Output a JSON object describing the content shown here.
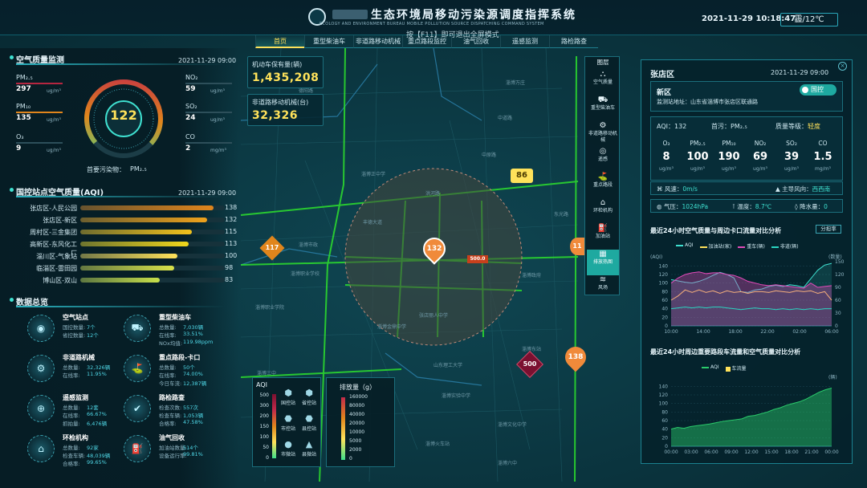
{
  "header": {
    "title": "生态环境局移动污染源调度指挥系统",
    "subtitle": "ECOLOGY AND ENVIRONMENT BUREAU MOBILE POLLUTION SOURCE DISPATCHING COMMAND SYSTEM",
    "datetime": "2021-11-29 10:18:47",
    "weather": "霾/12℃",
    "hint": "按【F11】即可退出全屏模式"
  },
  "nav": [
    "首页",
    "重型柴油车",
    "非道路移动机械",
    "重点路段监控",
    "油气回收",
    "遥感监测",
    "路检路查"
  ],
  "air": {
    "title": "空气质量监测",
    "date": "2021-11-29 09:00",
    "aqi": "122",
    "primary_label": "首要污染物：",
    "primary_value": "PM₂.₅",
    "items": [
      {
        "name": "PM₂.₅",
        "value": "297",
        "unit": "ug/m³"
      },
      {
        "name": "NO₂",
        "value": "59",
        "unit": "ug/m³"
      },
      {
        "name": "PM₁₀",
        "value": "135",
        "unit": "ug/m³"
      },
      {
        "name": "SO₂",
        "value": "24",
        "unit": "ug/m³"
      },
      {
        "name": "O₃",
        "value": "9",
        "unit": "ug/m³"
      },
      {
        "name": "CO",
        "value": "2",
        "unit": "mg/m³"
      }
    ]
  },
  "rank": {
    "title": "国控站点空气质量(AQI)",
    "date": "2021-11-29 09:00",
    "rows": [
      {
        "name": "张店区-人民公园",
        "value": "138",
        "frac": 0.92
      },
      {
        "name": "张店区-新区",
        "value": "132",
        "frac": 0.88
      },
      {
        "name": "周村区-三金集团",
        "value": "115",
        "frac": 0.77
      },
      {
        "name": "高新区-东风化工厂",
        "value": "113",
        "frac": 0.75
      },
      {
        "name": "淄川区-气象站",
        "value": "100",
        "frac": 0.67
      },
      {
        "name": "临淄区-雷田园",
        "value": "98",
        "frac": 0.65
      },
      {
        "name": "博山区-双山",
        "value": "83",
        "frac": 0.55
      }
    ]
  },
  "overview": {
    "title": "数据总览",
    "cards": [
      {
        "title": "空气站点",
        "icon": "air-station-icon",
        "glyph": "◉",
        "lines": [
          [
            "国控数量:",
            "7个"
          ],
          [
            "省控数量:",
            "12个"
          ]
        ]
      },
      {
        "title": "重型柴油车",
        "icon": "truck-icon",
        "glyph": "⛟",
        "lines": [
          [
            "总数量:",
            "7,030辆"
          ],
          [
            "在线率:",
            "33.51%"
          ],
          [
            "NOx均值:",
            "119.98ppm"
          ]
        ]
      },
      {
        "title": "非道路机械",
        "icon": "machine-icon",
        "glyph": "⚙",
        "lines": [
          [
            "总数量:",
            "32,326辆"
          ],
          [
            "在线率:",
            "11.95%"
          ]
        ]
      },
      {
        "title": "重点路段-卡口",
        "icon": "checkpoint-icon",
        "glyph": "⛳",
        "lines": [
          [
            "总数量:",
            "50个"
          ],
          [
            "在线率:",
            "74.00%"
          ],
          [
            "今日车流:",
            "12,387辆"
          ]
        ]
      },
      {
        "title": "遥感监测",
        "icon": "remote-sensing-icon",
        "glyph": "⊕",
        "lines": [
          [
            "总数量:",
            "12套"
          ],
          [
            "在线率:",
            "66.67%"
          ],
          [
            "抓拍量:",
            "6,476辆"
          ]
        ]
      },
      {
        "title": "路检路查",
        "icon": "road-check-icon",
        "glyph": "✔",
        "lines": [
          [
            "检查次数:",
            "557次"
          ],
          [
            "检查车辆:",
            "1,053辆"
          ],
          [
            "合格率:",
            "47.58%"
          ]
        ]
      },
      {
        "title": "环检机构",
        "icon": "inspection-icon",
        "glyph": "⌂",
        "lines": [
          [
            "总数量:",
            "92家"
          ],
          [
            "检查车辆:",
            "48,039辆"
          ],
          [
            "合格率:",
            "99.65%"
          ]
        ]
      },
      {
        "title": "油气回收",
        "icon": "fuel-icon",
        "glyph": "⛽",
        "lines": [
          [
            "加油站数量:",
            "514个"
          ],
          [
            "设备运行率:",
            "99.81%"
          ]
        ]
      }
    ]
  },
  "stats": [
    {
      "label": "机动车保有量(辆)",
      "value": "1,435,208"
    },
    {
      "label": "非道路移动机械(台)",
      "value": "32,326"
    }
  ],
  "layers": {
    "title": "图层",
    "items": [
      {
        "label": "空气质量",
        "icon": "air-quality-icon",
        "glyph": "⛬",
        "active": false
      },
      {
        "label": "重型柴油车",
        "icon": "truck-icon",
        "glyph": "⛟",
        "active": false
      },
      {
        "label": "非道路移动机械",
        "icon": "excavator-icon",
        "glyph": "⚙",
        "active": false
      },
      {
        "label": "遥感",
        "icon": "sensor-icon",
        "glyph": "◎",
        "active": false
      },
      {
        "label": "重点路段",
        "icon": "road-icon",
        "glyph": "⛳",
        "active": false
      },
      {
        "label": "环检机构",
        "icon": "building-icon",
        "glyph": "⌂",
        "active": false
      },
      {
        "label": "加油站",
        "icon": "fuel-icon",
        "glyph": "⛽",
        "active": false
      },
      {
        "label": "排放热图",
        "icon": "heatmap-icon",
        "glyph": "▦",
        "active": true
      },
      {
        "label": "风场",
        "icon": "wind-icon",
        "glyph": "≋",
        "active": false
      }
    ]
  },
  "detail": {
    "district": "张店区",
    "date": "2021-11-29 09:00",
    "station": "新区",
    "toggle": "国控",
    "address": "监测站地址：山东省淄博市张店区联通路",
    "aqi_label": "AQI：",
    "aqi": "132",
    "primary_label": "首污：",
    "primary": "PM₂.₅",
    "level_label": "质量等级：",
    "level": "轻度",
    "pollutants": [
      {
        "name": "O₃",
        "value": "8",
        "unit": "ug/m³"
      },
      {
        "name": "PM₂.₅",
        "value": "100",
        "unit": "ug/m³"
      },
      {
        "name": "PM₁₀",
        "value": "190",
        "unit": "ug/m³"
      },
      {
        "name": "NO₂",
        "value": "69",
        "unit": "ug/m³"
      },
      {
        "name": "SO₂",
        "value": "39",
        "unit": "ug/m³"
      },
      {
        "name": "CO",
        "value": "1.5",
        "unit": "mg/m³"
      }
    ],
    "wind_speed_label": "风速：",
    "wind_speed": "0m/s",
    "wind_dir_label": "主导风向：",
    "wind_dir": "西西南",
    "pressure_label": "气压：",
    "pressure": "1024hPa",
    "temp_label": "温度：",
    "temp": "8.7℃",
    "rain_label": "降水量：",
    "rain": "0"
  },
  "chart_data": [
    {
      "type": "area",
      "title": "最近24小时空气质量与周边卡口流量对比分析",
      "button": "分担率",
      "ylabel_left": "(AQI)",
      "ylabel_right": "(数量)",
      "ylim": [
        0,
        150
      ],
      "x": [
        "10:00",
        "14:00",
        "18:00",
        "22:00",
        "02:00",
        "06:00"
      ],
      "yticks": [
        0,
        20,
        40,
        60,
        80,
        100,
        120,
        140
      ],
      "yticks_right": [
        0,
        30,
        60,
        90,
        120,
        150
      ],
      "series": [
        {
          "name": "AQI",
          "color": "#3ee0d0",
          "values": [
            108,
            105,
            102,
            100,
            104,
            110,
            118,
            125,
            120,
            112,
            80,
            78,
            84,
            86,
            92,
            95,
            92,
            96,
            94,
            90,
            110,
            130,
            142,
            146
          ]
        },
        {
          "name": "加油站(家)",
          "color": "#ffe25a",
          "values": [
            60,
            70,
            84,
            78,
            84,
            78,
            82,
            76,
            82,
            78,
            80,
            76,
            80,
            80,
            78,
            82,
            80,
            78,
            82,
            80,
            82,
            76,
            80,
            60
          ]
        },
        {
          "name": "重车(辆)",
          "color": "#e04ab8",
          "values": [
            100,
            112,
            120,
            124,
            126,
            122,
            124,
            124,
            120,
            118,
            112,
            104,
            100,
            96,
            94,
            96,
            94,
            92,
            90,
            88,
            100,
            90,
            92,
            94
          ]
        },
        {
          "name": "非道(辆)",
          "color": "#2ad4c0",
          "values": [
            40,
            42,
            44,
            42,
            44,
            42,
            44,
            44,
            42,
            40,
            38,
            40,
            42,
            40,
            40,
            38,
            40,
            38,
            40,
            38,
            40,
            38,
            40,
            40
          ]
        }
      ]
    },
    {
      "type": "area",
      "title": "最近24小时周边重要路段车流量和空气质量对比分析",
      "ylim": [
        0,
        150
      ],
      "x": [
        "00:00",
        "03:00",
        "06:00",
        "09:00",
        "12:00",
        "15:00",
        "18:00",
        "21:00",
        "00:00"
      ],
      "yticks": [
        0,
        20,
        40,
        60,
        80,
        100,
        120,
        140
      ],
      "ylabel_right": "(辆)",
      "series": [
        {
          "name": "AQI",
          "color": "#2acb6b",
          "values": [
            40,
            44,
            42,
            46,
            48,
            50,
            52,
            55,
            58,
            60,
            62,
            64,
            70,
            72,
            76,
            80,
            86,
            90,
            96,
            100,
            104,
            110,
            118,
            126,
            132,
            136
          ]
        },
        {
          "name": "车流量",
          "color": "#ffe25a",
          "values": []
        }
      ]
    }
  ],
  "map": {
    "pins": [
      {
        "value": "86",
        "color": "#ffe25a",
        "text": "#4a3a00"
      },
      {
        "value": "117",
        "color": "#e0851c",
        "text": "#fff"
      },
      {
        "value": "132",
        "color": "#f08a3a",
        "text": "#fff"
      },
      {
        "value": "138",
        "color": "#f08a3a",
        "text": "#fff"
      },
      {
        "value": "500",
        "color": "#7a1030",
        "text": "#fff"
      },
      {
        "value": "11",
        "color": "#f08a3a",
        "text": "#fff"
      }
    ],
    "badge": "500.0",
    "roads": [
      "德阳路",
      "中道路",
      "洪河路",
      "淄博市政",
      "淄博职业学校",
      "淄博职业学院",
      "山东理工大学",
      "丰德大道",
      "中原路",
      "东光路",
      "淄博实验中学",
      "淄博金鼎中学",
      "淄博政府",
      "淄博东站",
      "淄博万庄",
      "张店丽人中学",
      "淄博文化中学",
      "淄博火车站",
      "淄博正中学",
      "淄博三中",
      "淄博六中"
    ]
  },
  "legend_aqi": {
    "title": "AQI",
    "scale": [
      "500",
      "300",
      "200",
      "150",
      "100",
      "50",
      "0"
    ],
    "items": [
      {
        "label": "国控站",
        "glyph": "⬢"
      },
      {
        "label": "省控站",
        "glyph": "⬢"
      },
      {
        "label": "市控站",
        "glyph": "⬣"
      },
      {
        "label": "县控站",
        "glyph": "⬣"
      },
      {
        "label": "市微站",
        "glyph": "●"
      },
      {
        "label": "县微站",
        "glyph": "▲"
      }
    ]
  },
  "legend_emission": {
    "title": "排放量（g）",
    "scale": [
      "160000",
      "80000",
      "40000",
      "20000",
      "10000",
      "5000",
      "2000",
      "0"
    ]
  }
}
